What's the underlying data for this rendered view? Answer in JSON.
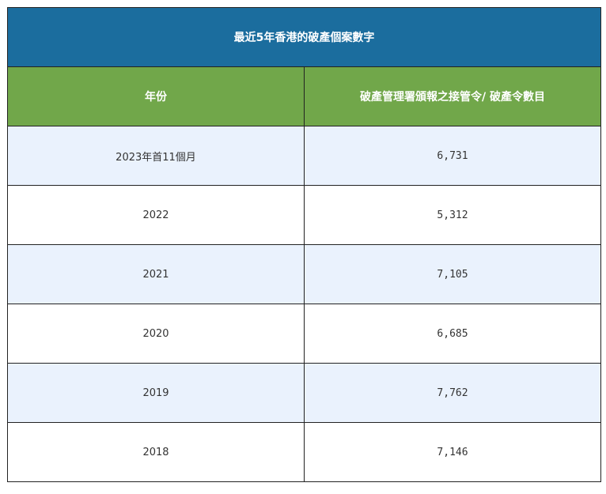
{
  "table": {
    "title": "最近5年香港的破產個案數字",
    "headers": [
      "年份",
      "破產管理署頒報之接管令/ 破產令數目"
    ],
    "rows": [
      {
        "year": "2023年首11個月",
        "count": "6,731"
      },
      {
        "year": "2022",
        "count": "5,312"
      },
      {
        "year": "2021",
        "count": "7,105"
      },
      {
        "year": "2020",
        "count": "6,685"
      },
      {
        "year": "2019",
        "count": "7,762"
      },
      {
        "year": "2018",
        "count": "7,146"
      }
    ],
    "colors": {
      "title_bg": "#1b6d9e",
      "header_bg": "#71a74a",
      "shaded_row_bg": "#eaf2fd"
    }
  }
}
